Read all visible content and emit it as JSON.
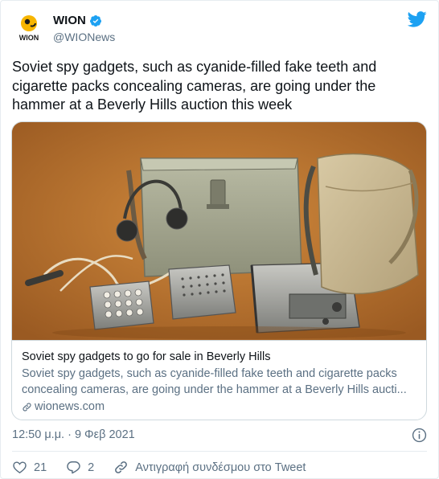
{
  "author": {
    "display_name": "WION",
    "handle": "@WIONews",
    "logo_text": "WION",
    "verified_icon": "verified-badge-icon",
    "platform_icon": "twitter-bird-icon"
  },
  "tweet": {
    "text": "Soviet spy gadgets, such as cyanide-filled fake teeth and cigarette packs concealing cameras, are going under the hammer at a Beverly Hills auction this week",
    "timestamp": "12:50 μ.μ. · 9 Φεβ 2021"
  },
  "card": {
    "title": "Soviet spy gadgets to go for sale in Beverly Hills",
    "description": "Soviet spy gadgets, such as cyanide-filled fake teeth and cigarette packs concealing cameras, are going under the hammer at a Beverly Hills aucti...",
    "domain": "wionews.com",
    "image_icon": "spy-gadgets-photo"
  },
  "actions": {
    "like_count": "21",
    "reply_count": "2",
    "copy_link_label": "Αντιγραφή συνδέσμου στο Tweet"
  },
  "colors": {
    "accent": "#1da1f2",
    "secondary_text": "#5b7083",
    "border": "#cfd9de",
    "logo_yellow": "#f7b500"
  }
}
